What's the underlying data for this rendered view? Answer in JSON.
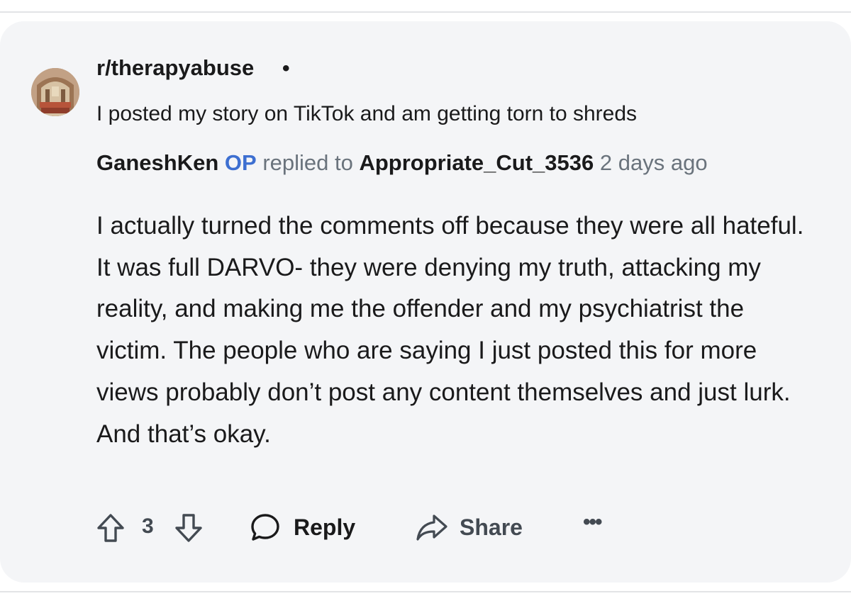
{
  "post": {
    "subreddit": "r/therapyabuse",
    "separator": "•",
    "title": "I posted my story on TikTok and am getting torn to shreds"
  },
  "comment": {
    "author": "GaneshKen",
    "op_badge": "OP",
    "replied_to_text": "replied to",
    "parent_author": "Appropriate_Cut_3536",
    "time": "2 days ago",
    "body": "I actually turned the comments off because they were all hateful. It was full DARVO- they were denying my truth, attacking my reality, and making me the offender and my psychiatrist the victim. The people who are saying I just posted this for more views probably don’t post any content themselves and just lurk. And that’s okay."
  },
  "actions": {
    "vote_count": "3",
    "reply_label": "Reply",
    "share_label": "Share",
    "more_label": "•••"
  },
  "icons": {
    "upvote": "upvote-arrow-icon",
    "downvote": "downvote-arrow-icon",
    "reply": "speech-bubble-icon",
    "share": "share-arrow-icon",
    "more": "ellipsis-icon"
  },
  "colors": {
    "card_background": "#f4f5f7",
    "op_badge": "#3d6fd1",
    "text_primary": "#1a1a1b",
    "text_muted": "#6a737c"
  }
}
